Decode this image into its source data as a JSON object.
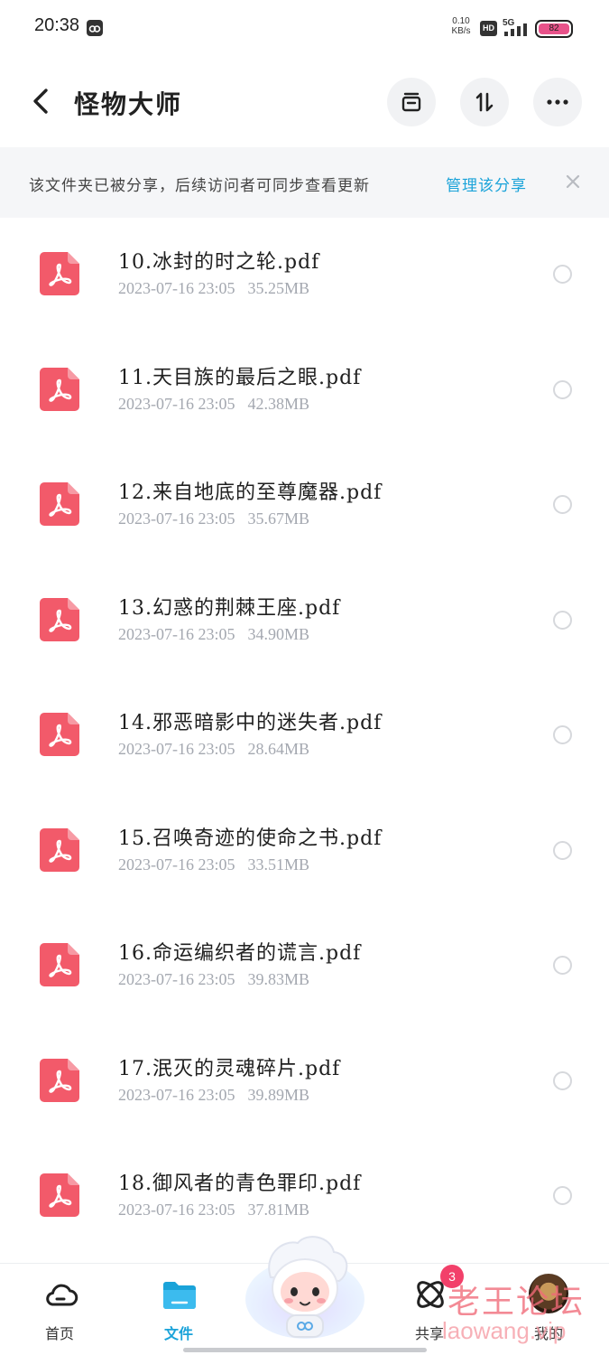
{
  "status_bar": {
    "time": "20:38",
    "net_speed_value": "0.10",
    "net_speed_unit": "KB/s",
    "hd_label": "HD",
    "network": "5G",
    "battery": "82",
    "battery_color": "#e8528a"
  },
  "header": {
    "back_icon": "chevron-left-icon",
    "title": "怪物大师",
    "actions": [
      "archive-icon",
      "sort-icon",
      "more-icon"
    ]
  },
  "share_banner": {
    "text": "该文件夹已被分享，后续访问者可同步查看更新",
    "link": "管理该分享",
    "close_icon": "close-icon"
  },
  "files": [
    {
      "name": "10.冰封的时之轮.pdf",
      "date": "2023-07-16 23:05",
      "size": "35.25MB"
    },
    {
      "name": "11.天目族的最后之眼.pdf",
      "date": "2023-07-16 23:05",
      "size": "42.38MB"
    },
    {
      "name": "12.来自地底的至尊魔器.pdf",
      "date": "2023-07-16 23:05",
      "size": "35.67MB"
    },
    {
      "name": "13.幻惑的荆棘王座.pdf",
      "date": "2023-07-16 23:05",
      "size": "34.90MB"
    },
    {
      "name": "14.邪恶暗影中的迷失者.pdf",
      "date": "2023-07-16 23:05",
      "size": "28.64MB"
    },
    {
      "name": "15.召唤奇迹的使命之书.pdf",
      "date": "2023-07-16 23:05",
      "size": "33.51MB"
    },
    {
      "name": "16.命运编织者的谎言.pdf",
      "date": "2023-07-16 23:05",
      "size": "39.83MB"
    },
    {
      "name": "17.泯灭的灵魂碎片.pdf",
      "date": "2023-07-16 23:05",
      "size": "39.89MB"
    },
    {
      "name": "18.御风者的青色罪印.pdf",
      "date": "2023-07-16 23:05",
      "size": "37.81MB"
    }
  ],
  "bottom_nav": {
    "items": [
      {
        "label": "首页",
        "icon": "cloud-icon"
      },
      {
        "label": "文件",
        "icon": "folder-icon",
        "active": true
      },
      {
        "label": "共享",
        "icon": "share-orbit-icon",
        "badge": "3"
      },
      {
        "label": "我的",
        "icon": "avatar"
      }
    ],
    "accent_color": "#1aa3d9"
  },
  "watermark": {
    "line1": "老王论坛",
    "line2": "laowang.vip"
  }
}
